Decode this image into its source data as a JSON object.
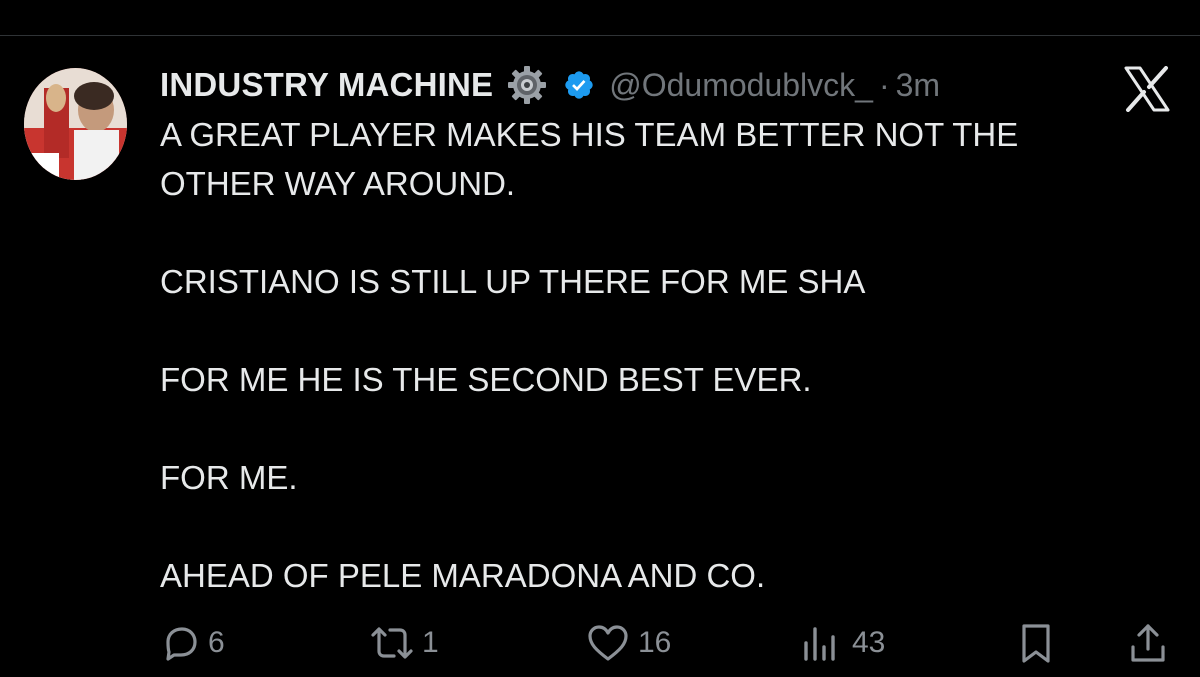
{
  "tweet": {
    "display_name": "INDUSTRY MACHINE",
    "handle": "@Odumodublvck_",
    "separator": "·",
    "time": "3m",
    "lines": [
      "A GREAT PLAYER MAKES HIS TEAM BETTER NOT THE",
      "OTHER WAY AROUND.",
      "",
      "CRISTIANO IS STILL UP THERE FOR ME SHA",
      "",
      "FOR ME HE IS THE SECOND BEST EVER.",
      "",
      "FOR ME.",
      "",
      "AHEAD OF PELE MARADONA AND CO."
    ]
  },
  "actions": {
    "replies": "6",
    "reposts": "1",
    "likes": "16",
    "views": "43"
  },
  "icons": {
    "emoji": "gear-icon",
    "badge": "verified-badge-icon",
    "platform": "x-logo-icon",
    "reply": "reply-icon",
    "repost": "repost-icon",
    "like": "heart-icon",
    "views": "views-icon",
    "bookmark": "bookmark-icon",
    "share": "share-icon"
  },
  "colors": {
    "background": "#000000",
    "text": "#e7e9ea",
    "secondary": "#71767b",
    "verified": "#1d9bf0"
  }
}
